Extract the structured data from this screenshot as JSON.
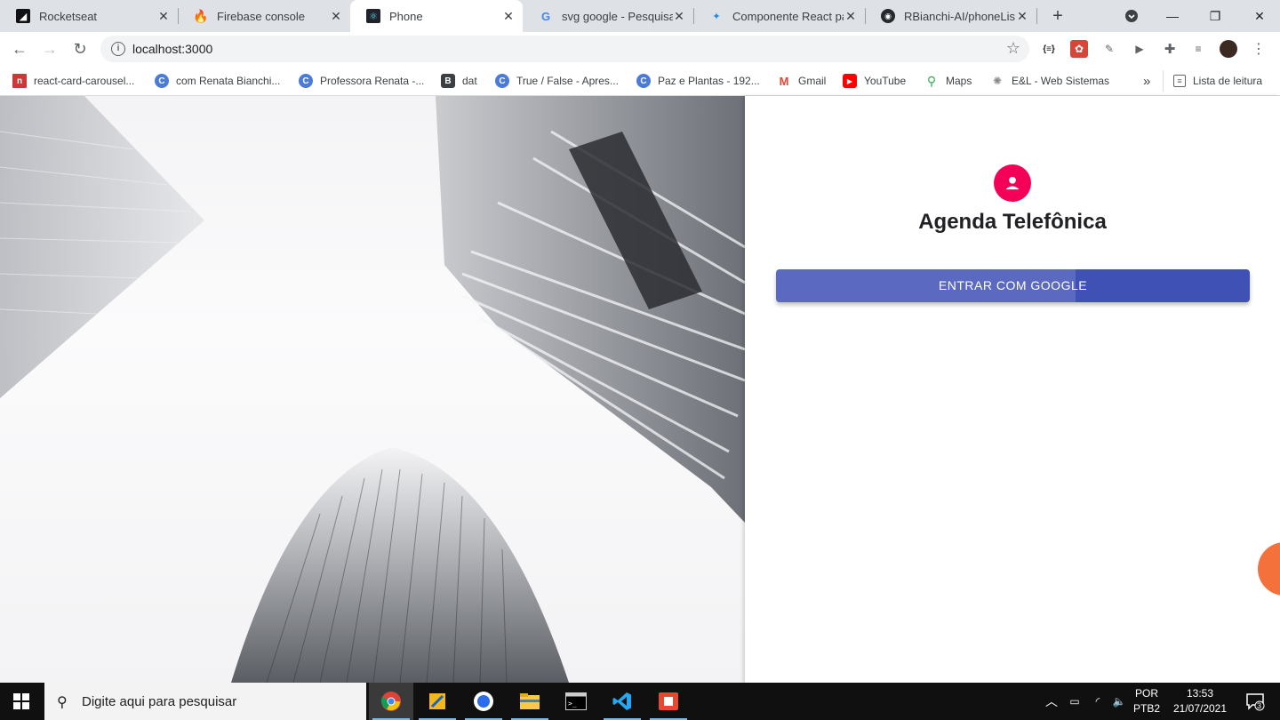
{
  "browser": {
    "tabs": [
      {
        "title": "Rocketseat",
        "icon": "rocketseat-icon"
      },
      {
        "title": "Firebase console",
        "icon": "firebase-icon"
      },
      {
        "title": "Phone",
        "icon": "react-icon",
        "active": true
      },
      {
        "title": "svg google - Pesquisa",
        "icon": "google-icon"
      },
      {
        "title": "Componente React pa",
        "icon": "react-component-icon"
      },
      {
        "title": "RBianchi-AI/phoneList",
        "icon": "github-icon"
      }
    ],
    "url": "localhost:3000",
    "bookmarks": [
      {
        "label": "react-card-carousel...",
        "icon": "npm-icon"
      },
      {
        "label": "com Renata Bianchi...",
        "icon": "c-icon"
      },
      {
        "label": "Professora Renata -...",
        "icon": "c-icon"
      },
      {
        "label": "dat",
        "icon": "b-icon"
      },
      {
        "label": "True / False - Apres...",
        "icon": "c-icon"
      },
      {
        "label": "Paz e Plantas - 192...",
        "icon": "c-icon"
      },
      {
        "label": "Gmail",
        "icon": "gmail-icon"
      },
      {
        "label": "YouTube",
        "icon": "youtube-icon"
      },
      {
        "label": "Maps",
        "icon": "maps-icon"
      },
      {
        "label": "E&L - Web Sistemas",
        "icon": "el-icon"
      }
    ],
    "overflow_label": "»",
    "reading_list": "Lista de leitura"
  },
  "page": {
    "title": "Agenda Telefônica",
    "login_button": "ENTRAR COM GOOGLE",
    "accent_color": "#f50057",
    "button_color": "#3f51b5"
  },
  "taskbar": {
    "search_placeholder": "Digite aqui para pesquisar",
    "lang_top": "POR",
    "lang_bottom": "PTB2",
    "time": "13:53",
    "date": "21/07/2021",
    "notifications": "3"
  }
}
